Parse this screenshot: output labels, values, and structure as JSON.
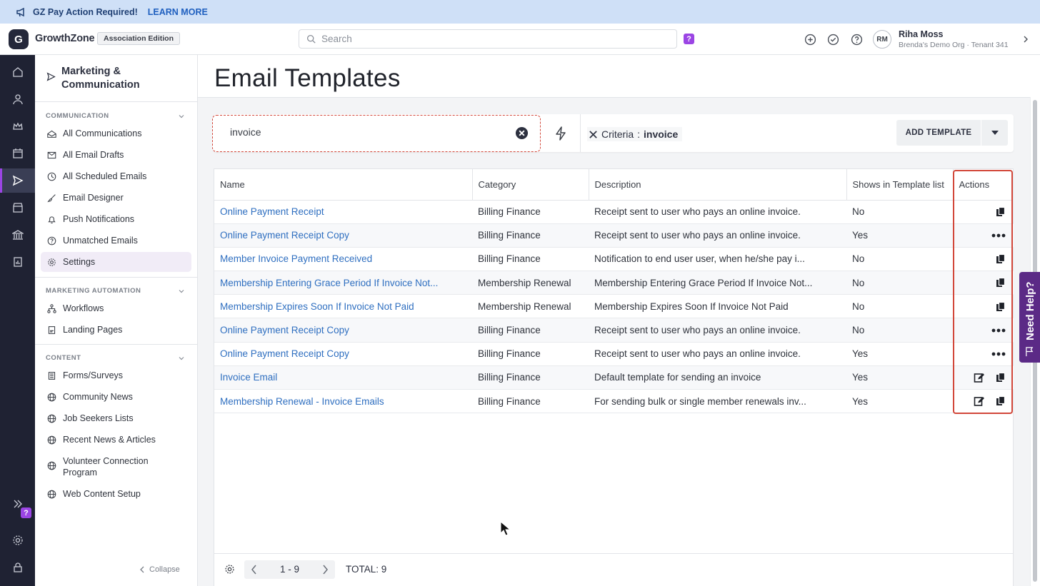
{
  "banner": {
    "message": "GZ Pay Action Required!",
    "link": "LEARN MORE"
  },
  "topbar": {
    "brand": "GrowthZone",
    "edition": "Association Edition",
    "search_placeholder": "Search",
    "help_badge": "?",
    "user": {
      "initials": "RM",
      "name": "Riha Moss",
      "org": "Brenda's Demo Org · Tenant 341"
    }
  },
  "rail": {
    "help_badge": "?"
  },
  "sidenav": {
    "title": "Marketing & Communication",
    "sections": {
      "communication": "COMMUNICATION",
      "automation": "MARKETING AUTOMATION",
      "content": "CONTENT"
    },
    "items": [
      {
        "label": "All Communications",
        "icon": "inbox-icon"
      },
      {
        "label": "All Email Drafts",
        "icon": "mail-icon"
      },
      {
        "label": "All Scheduled Emails",
        "icon": "clock-icon"
      },
      {
        "label": "Email Designer",
        "icon": "brush-icon"
      },
      {
        "label": "Push Notifications",
        "icon": "bell-icon"
      },
      {
        "label": "Unmatched Emails",
        "icon": "question-circle-icon"
      },
      {
        "label": "Settings",
        "icon": "gear-icon"
      },
      {
        "label": "Workflows",
        "icon": "workflow-icon"
      },
      {
        "label": "Landing Pages",
        "icon": "page-icon"
      },
      {
        "label": "Forms/Surveys",
        "icon": "form-icon"
      },
      {
        "label": "Community News",
        "icon": "globe-icon"
      },
      {
        "label": "Job Seekers Lists",
        "icon": "globe-icon"
      },
      {
        "label": "Recent News & Articles",
        "icon": "globe-icon"
      },
      {
        "label": "Volunteer Connection Program",
        "icon": "globe-icon"
      },
      {
        "label": "Web Content Setup",
        "icon": "globe-icon"
      }
    ],
    "collapse": "Collapse"
  },
  "page": {
    "title": "Email Templates"
  },
  "filter": {
    "query": "invoice",
    "criteria_label": "Criteria",
    "criteria_value": "invoice",
    "add_button": "ADD TEMPLATE"
  },
  "table": {
    "headers": [
      "Name",
      "Category",
      "Description",
      "Shows in Template list",
      "Actions"
    ],
    "rows": [
      {
        "name": "Online Payment Receipt",
        "category": "Billing Finance",
        "description": "Receipt sent to user who pays an online invoice.",
        "shows": "No",
        "actions": [
          "copy"
        ]
      },
      {
        "name": "Online Payment Receipt Copy",
        "category": "Billing Finance",
        "description": "Receipt sent to user who pays an online invoice.",
        "shows": "Yes",
        "actions": [
          "more"
        ]
      },
      {
        "name": "Member Invoice Payment Received",
        "category": "Billing Finance",
        "description": "Notification to end user user, when he/she pay i...",
        "shows": "No",
        "actions": [
          "copy"
        ]
      },
      {
        "name": "Membership Entering Grace Period If Invoice Not...",
        "category": "Membership Renewal",
        "description": "Membership Entering Grace Period If Invoice Not...",
        "shows": "No",
        "actions": [
          "copy"
        ]
      },
      {
        "name": "Membership Expires Soon If Invoice Not Paid",
        "category": "Membership Renewal",
        "description": "Membership Expires Soon If Invoice Not Paid",
        "shows": "No",
        "actions": [
          "copy"
        ]
      },
      {
        "name": "Online Payment Receipt Copy",
        "category": "Billing Finance",
        "description": "Receipt sent to user who pays an online invoice.",
        "shows": "No",
        "actions": [
          "more"
        ]
      },
      {
        "name": "Online Payment Receipt Copy",
        "category": "Billing Finance",
        "description": "Receipt sent to user who pays an online invoice.",
        "shows": "Yes",
        "actions": [
          "more"
        ]
      },
      {
        "name": "Invoice Email",
        "category": "Billing Finance",
        "description": "Default template for sending an invoice",
        "shows": "Yes",
        "actions": [
          "edit",
          "copy"
        ]
      },
      {
        "name": "Membership Renewal - Invoice Emails",
        "category": "Billing Finance",
        "description": "For sending bulk or single member renewals inv...",
        "shows": "Yes",
        "actions": [
          "edit",
          "copy"
        ]
      }
    ]
  },
  "footer": {
    "range": "1 - 9",
    "total": "TOTAL: 9"
  },
  "need_help": "Need Help?",
  "colors": {
    "accent": "#9b45e4",
    "rail": "#1f2233",
    "link": "#2f6fc0",
    "highlight": "#d2473a"
  }
}
